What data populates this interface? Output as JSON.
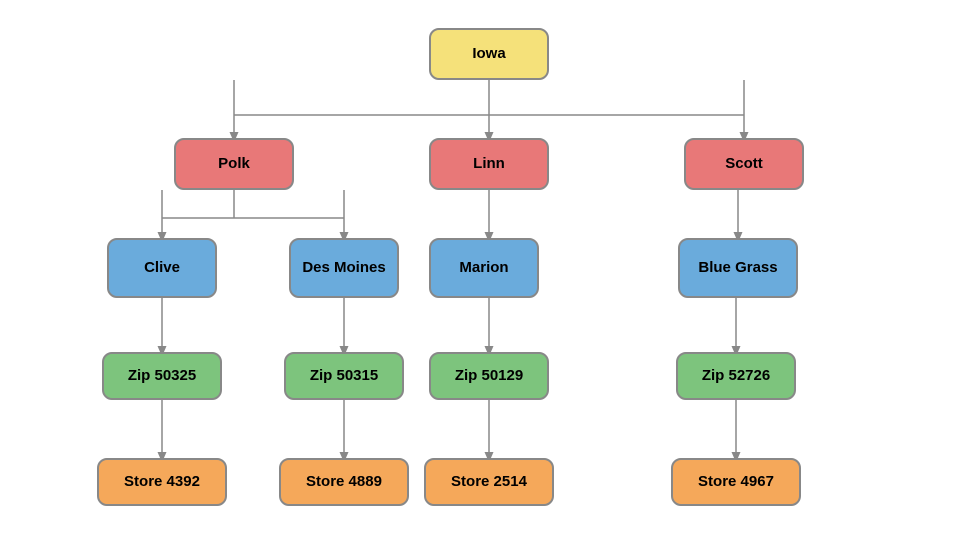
{
  "nodes": {
    "iowa": {
      "label": "Iowa"
    },
    "polk": {
      "label": "Polk"
    },
    "linn": {
      "label": "Linn"
    },
    "scott": {
      "label": "Scott"
    },
    "clive": {
      "label": "Clive"
    },
    "des_moines": {
      "label": "Des Moines"
    },
    "marion": {
      "label": "Marion"
    },
    "blue_grass": {
      "label": "Blue Grass"
    },
    "zip50325": {
      "label": "Zip 50325"
    },
    "zip50315": {
      "label": "Zip 50315"
    },
    "zip50129": {
      "label": "Zip 50129"
    },
    "zip52726": {
      "label": "Zip 52726"
    },
    "store4392": {
      "label": "Store 4392"
    },
    "store4889": {
      "label": "Store 4889"
    },
    "store2514": {
      "label": "Store 2514"
    },
    "store4967": {
      "label": "Store 4967"
    }
  }
}
